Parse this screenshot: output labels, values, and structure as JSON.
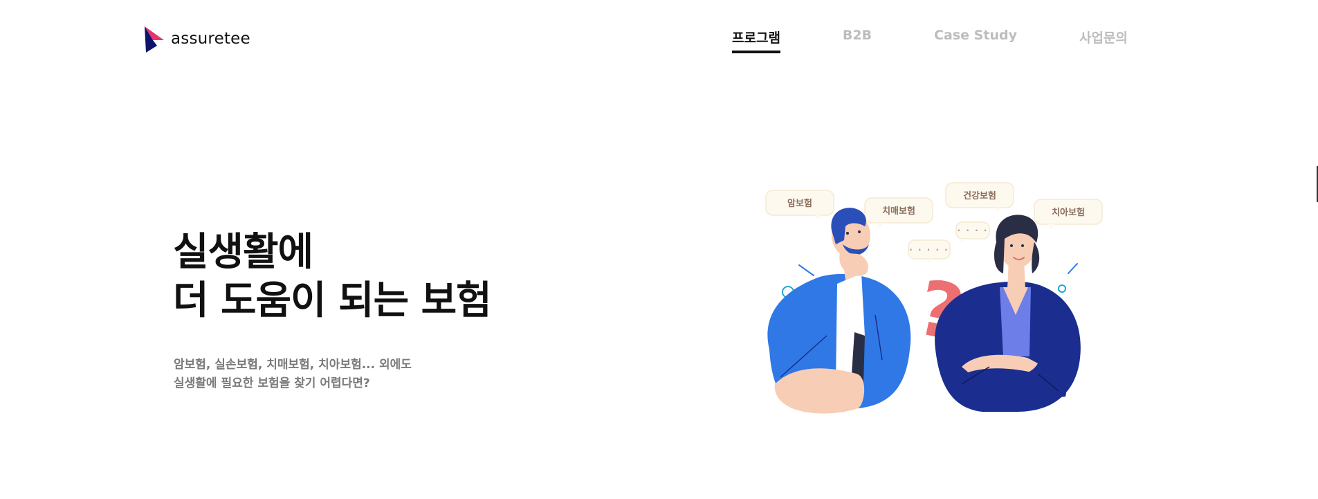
{
  "header": {
    "logo_text": "assuretee",
    "nav": [
      {
        "label": "프로그램",
        "active": true
      },
      {
        "label": "B2B",
        "active": false
      },
      {
        "label": "Case Study",
        "active": false
      },
      {
        "label": "사업문의",
        "active": false
      }
    ]
  },
  "hero": {
    "title_lines": [
      "실생활에",
      "더 도움이 되는 보험"
    ],
    "desc_lines": [
      "암보험, 실손보험, 치매보험, 치아보험... 외에도",
      "실생활에 필요한 보험을 찾기 어렵다면?"
    ]
  },
  "illustration": {
    "bubbles": [
      "암보험",
      "치매보험",
      "건강보험",
      "치아보험"
    ],
    "dots": [
      "· · · · ·",
      "· · · ·"
    ],
    "question_mark": "?"
  },
  "colors": {
    "logo_pink": "#e8336d",
    "logo_navy": "#10136b",
    "active_nav": "#111111",
    "inactive_nav": "#bdbdbd",
    "blue_suit": "#2f78e6",
    "navy_suit": "#1b2e8f",
    "question_mark": "#ec6f72",
    "bubble_bg": "#fdf9ee"
  }
}
